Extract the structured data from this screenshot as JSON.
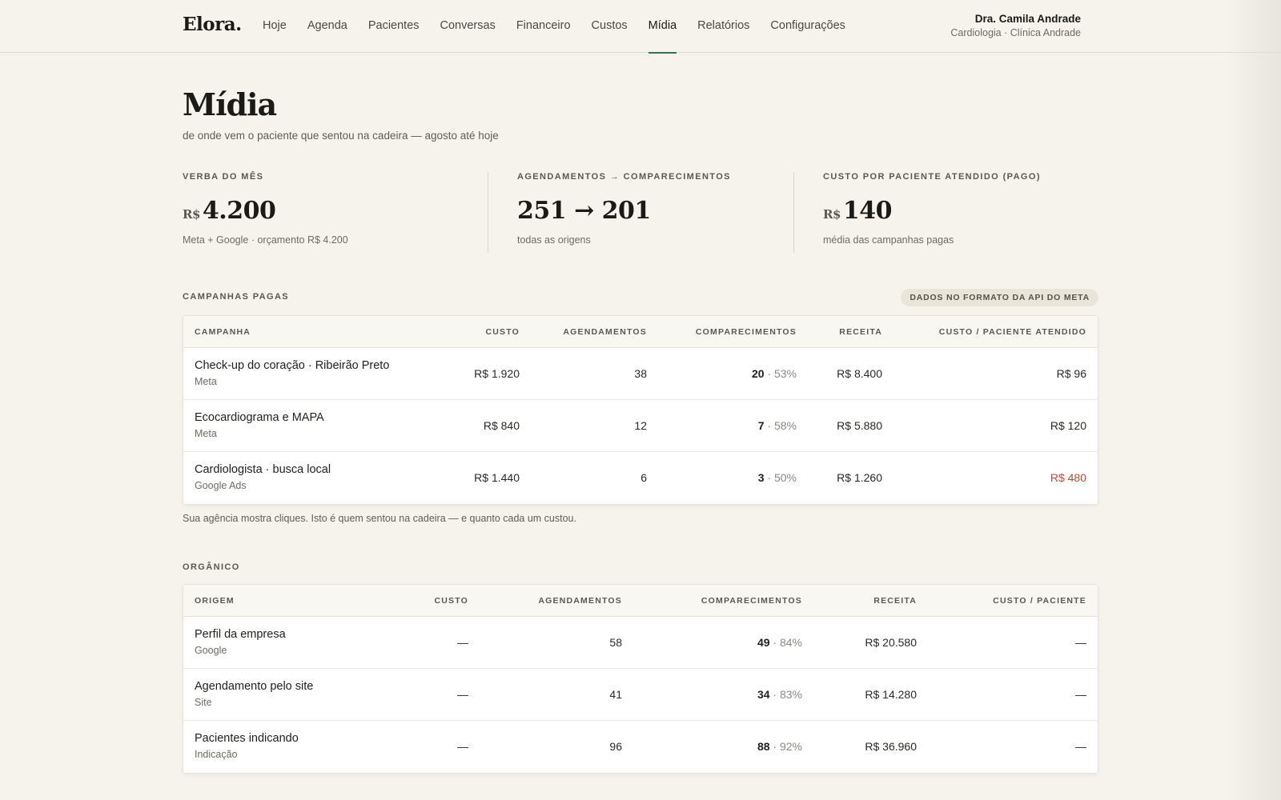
{
  "app": {
    "logo": "Elora."
  },
  "nav": [
    {
      "label": "Hoje"
    },
    {
      "label": "Agenda"
    },
    {
      "label": "Pacientes"
    },
    {
      "label": "Conversas"
    },
    {
      "label": "Financeiro"
    },
    {
      "label": "Custos"
    },
    {
      "label": "Mídia",
      "active": true
    },
    {
      "label": "Relatórios"
    },
    {
      "label": "Configurações"
    }
  ],
  "user": {
    "name": "Dra. Camila Andrade",
    "subtitle": "Cardiologia · Clínica Andrade"
  },
  "page": {
    "title": "Mídia",
    "subtitle": "de onde vem o paciente que sentou na cadeira — agosto até hoje"
  },
  "kpis": [
    {
      "label": "VERBA DO MÊS",
      "prefix": "R$",
      "value": "4.200",
      "note": "Meta + Google · orçamento R$ 4.200"
    },
    {
      "label": "AGENDAMENTOS → COMPARECIMENTOS",
      "prefix": "",
      "value": "251 → 201",
      "note": "todas as origens"
    },
    {
      "label": "CUSTO POR PACIENTE ATENDIDO (PAGO)",
      "prefix": "R$",
      "value": "140",
      "note": "média das campanhas pagas"
    }
  ],
  "paid": {
    "section_label": "CAMPANHAS PAGAS",
    "badge": "DADOS NO FORMATO DA API DO META",
    "columns": [
      "CAMPANHA",
      "CUSTO",
      "AGENDAMENTOS",
      "COMPARECIMENTOS",
      "RECEITA",
      "CUSTO / PACIENTE ATENDIDO"
    ],
    "rows": [
      {
        "name": "Check-up do coração · Ribeirão Preto",
        "source": "Meta",
        "cost": "R$ 1.920",
        "bookings": "38",
        "attend": "20",
        "attend_pct": "· 53%",
        "revenue": "R$ 8.400",
        "cpp": "R$ 96",
        "cpp_alert": false
      },
      {
        "name": "Ecocardiograma e MAPA",
        "source": "Meta",
        "cost": "R$ 840",
        "bookings": "12",
        "attend": "7",
        "attend_pct": "· 58%",
        "revenue": "R$ 5.880",
        "cpp": "R$ 120",
        "cpp_alert": false
      },
      {
        "name": "Cardiologista · busca local",
        "source": "Google Ads",
        "cost": "R$ 1.440",
        "bookings": "6",
        "attend": "3",
        "attend_pct": "· 50%",
        "revenue": "R$ 1.260",
        "cpp": "R$ 480",
        "cpp_alert": true
      }
    ],
    "footnote": "Sua agência mostra cliques. Isto é quem sentou na cadeira — e quanto cada um custou.",
    "alert_color": "#c0473b"
  },
  "organic": {
    "section_label": "ORGÂNICO",
    "columns": [
      "ORIGEM",
      "CUSTO",
      "AGENDAMENTOS",
      "COMPARECIMENTOS",
      "RECEITA",
      "CUSTO / PACIENTE"
    ],
    "rows": [
      {
        "name": "Perfil da empresa",
        "source": "Google",
        "cost": "—",
        "bookings": "58",
        "attend": "49",
        "attend_pct": "· 84%",
        "revenue": "R$ 20.580",
        "cpp": "—"
      },
      {
        "name": "Agendamento pelo site",
        "source": "Site",
        "cost": "—",
        "bookings": "41",
        "attend": "34",
        "attend_pct": "· 83%",
        "revenue": "R$ 14.280",
        "cpp": "—"
      },
      {
        "name": "Pacientes indicando",
        "source": "Indicação",
        "cost": "—",
        "bookings": "96",
        "attend": "88",
        "attend_pct": "· 92%",
        "revenue": "R$ 36.960",
        "cpp": "—"
      }
    ]
  },
  "theme": {
    "accent": "#3e6b57",
    "background": "#f5f3ec"
  }
}
